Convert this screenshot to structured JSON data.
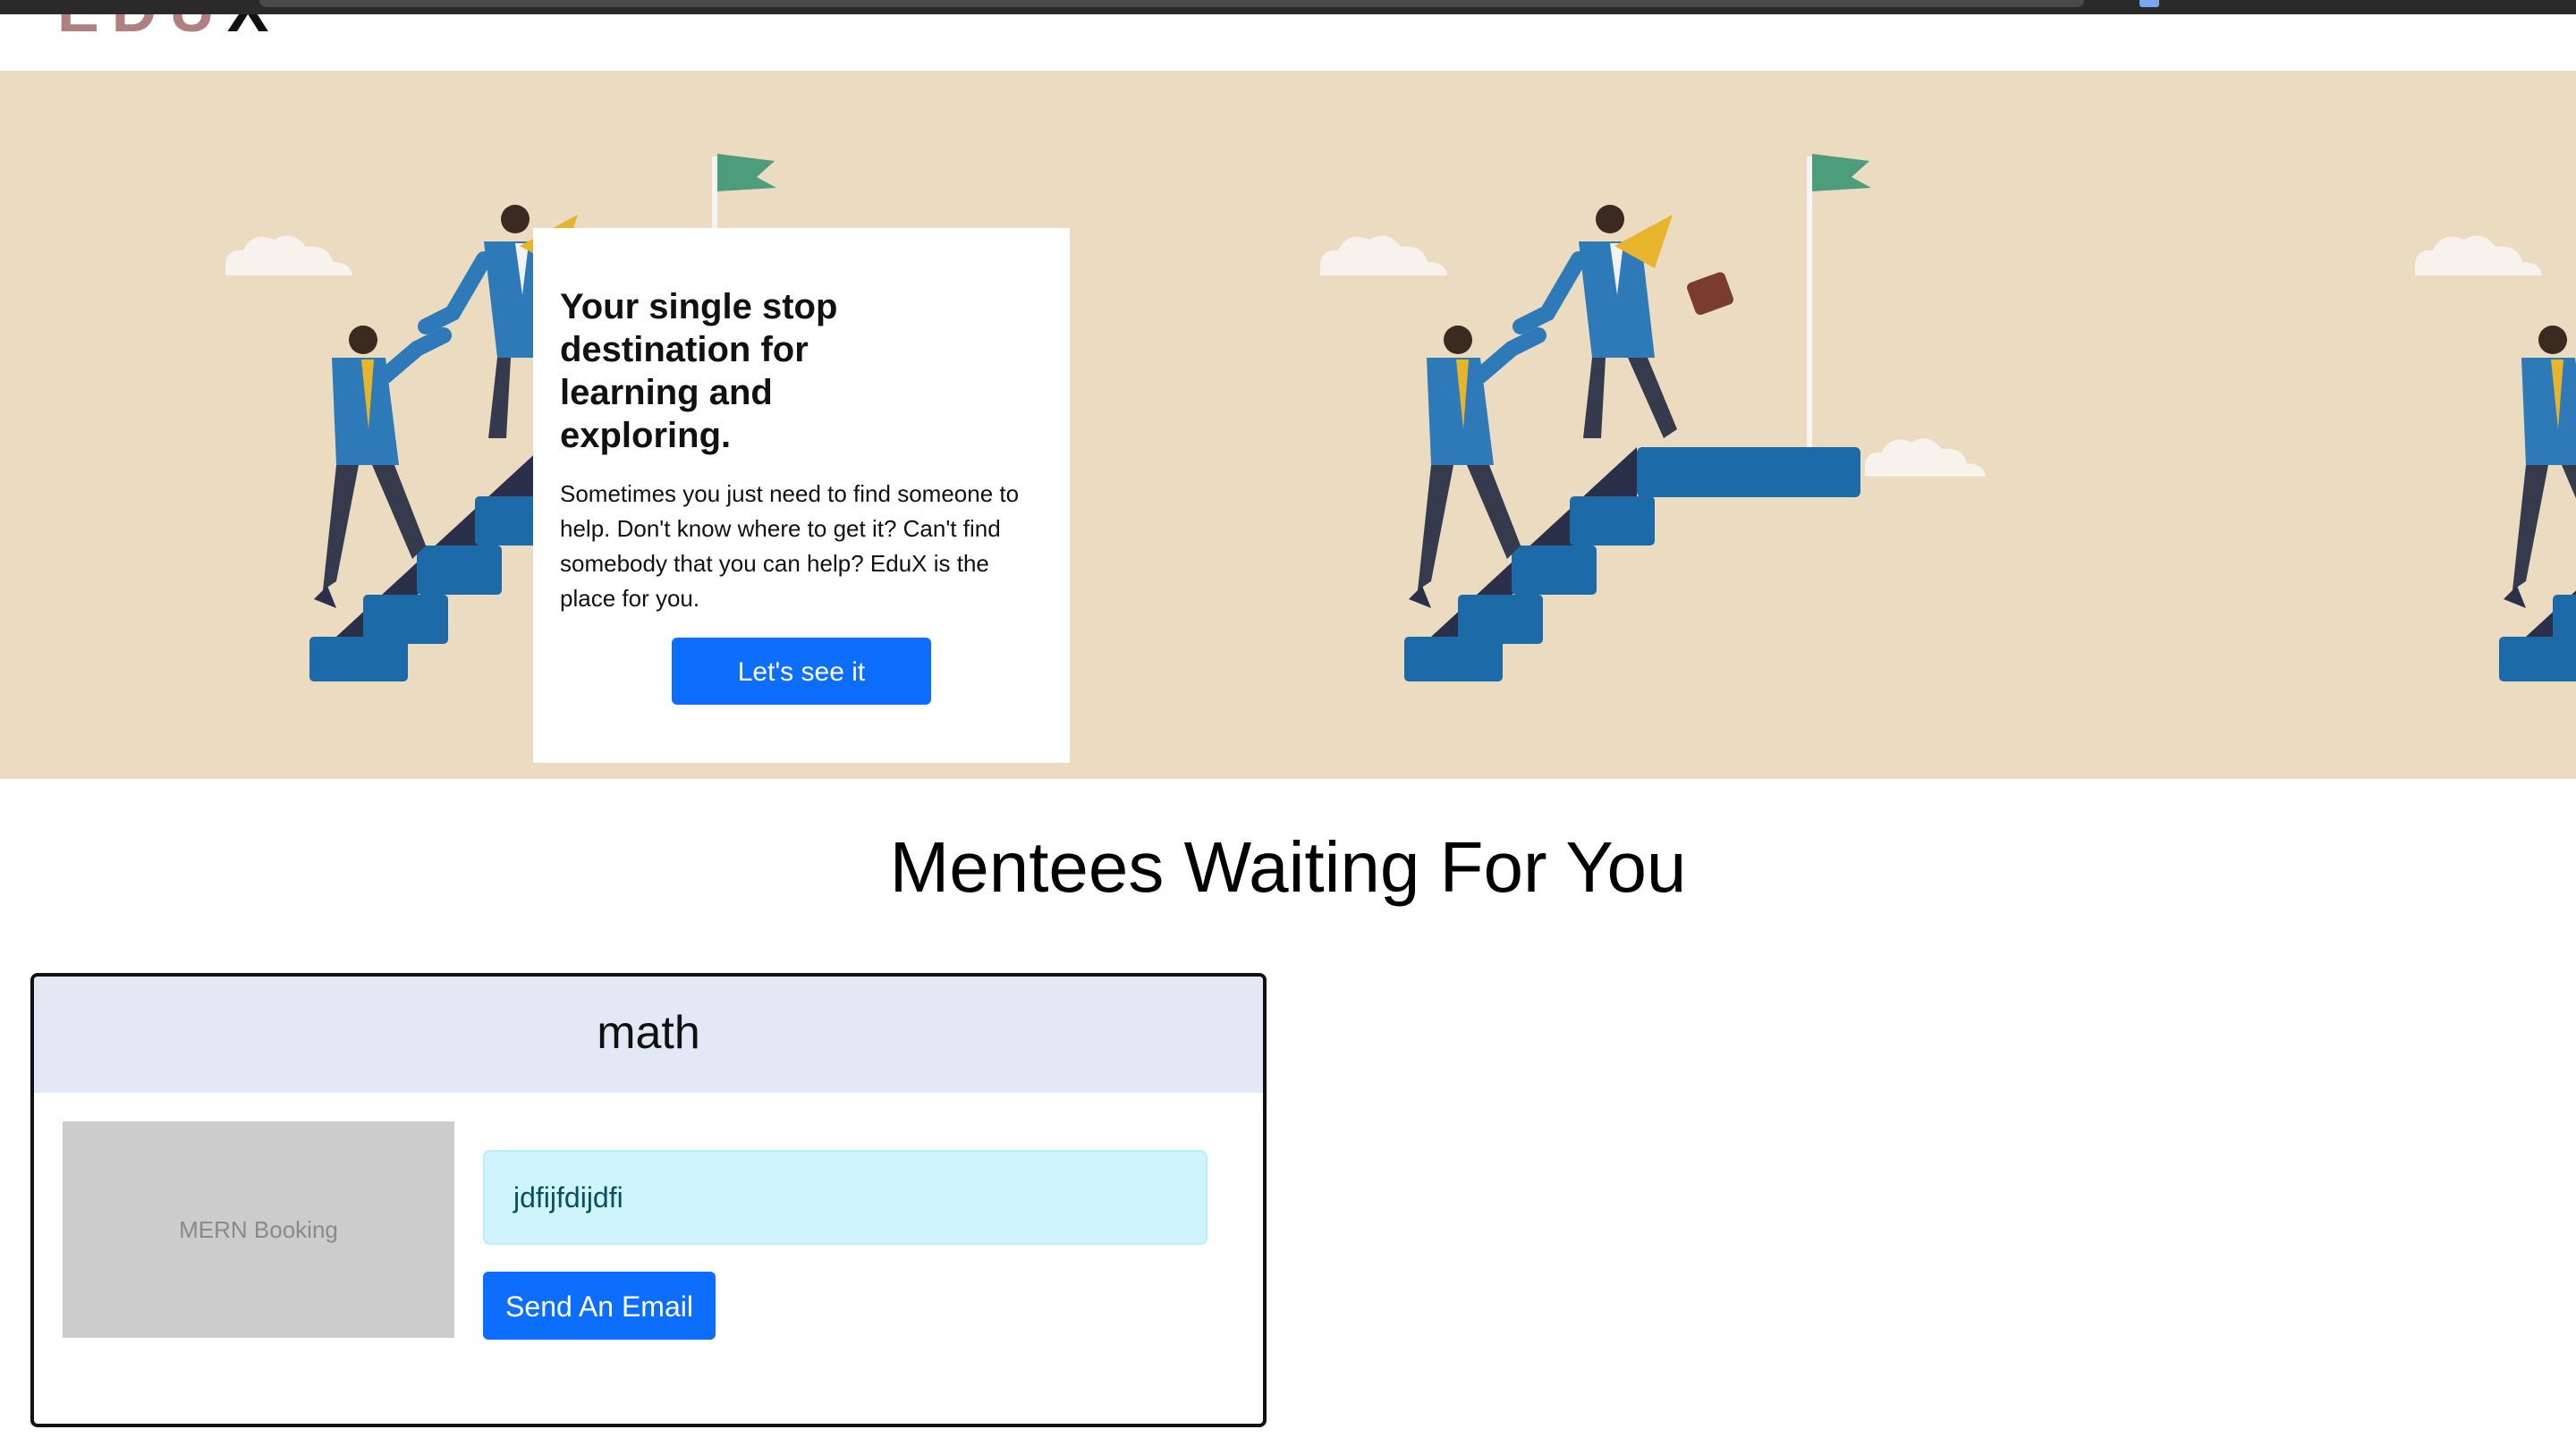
{
  "navbar": {
    "brand_prefix": "EDU",
    "brand_suffix": "X"
  },
  "hero": {
    "heading": "Your single stop destination for learning and exploring.",
    "body": "Sometimes you just need to find someone to help. Don't know where to get it? Can't find somebody that you can help? EduX is the place for you.",
    "cta_label": "Let's see it",
    "background_color": "#ebdcc1"
  },
  "mentees": {
    "title": "Mentees Waiting For You",
    "cards": [
      {
        "subject": "math",
        "image_alt": "MERN Booking",
        "description": "jdfijfdijdfi",
        "action_label": "Send An Email"
      }
    ]
  },
  "colors": {
    "primary": "#0d6efd",
    "info_bg": "#cff4fc",
    "card_header": "#e3e8f5"
  }
}
